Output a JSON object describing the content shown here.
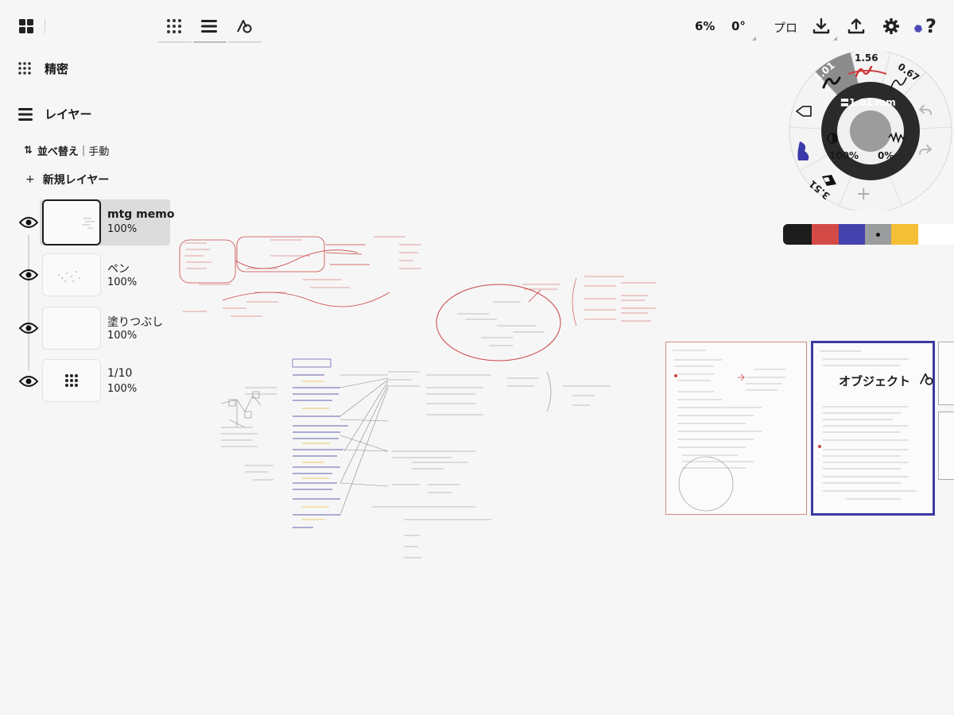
{
  "toolbar": {
    "zoom": "6%",
    "rotation": "0°",
    "mode": "プロ",
    "icons": [
      "grid-menu-icon",
      "precision-grid-icon",
      "layers-icon",
      "object-shape-icon",
      "download-icon",
      "upload-icon",
      "settings-icon",
      "help-icon"
    ]
  },
  "sidebar": {
    "precision_label": "精密",
    "layers_label": "レイヤー",
    "sort_label": "並べ替え",
    "sort_separator": "|",
    "sort_mode": "手動",
    "new_layer_label": "新規レイヤー",
    "layers": [
      {
        "name": "mtg memo",
        "opacity": "100%",
        "selected": true
      },
      {
        "name": "ペン",
        "opacity": "100%",
        "selected": false
      },
      {
        "name": "塗りつぶし",
        "opacity": "100%",
        "selected": false
      },
      {
        "name": "1/10",
        "opacity": "100%",
        "selected": false
      }
    ]
  },
  "tool_wheel": {
    "brush_sizes": [
      "1.01",
      "1.56",
      "0.67",
      "3.51"
    ],
    "size_readout": "1.01 mm",
    "opacity": "100%",
    "smoothing": "0%",
    "add_symbol": "+"
  },
  "palette": {
    "colors": [
      "#1c1c1c",
      "#d44a47",
      "#4442ad",
      "#9a9c9d",
      "#f5bf35",
      "#ffffff"
    ]
  },
  "canvas": {
    "object_label": "オブジェクト",
    "selected_frame_color": "#3a3aa0"
  }
}
